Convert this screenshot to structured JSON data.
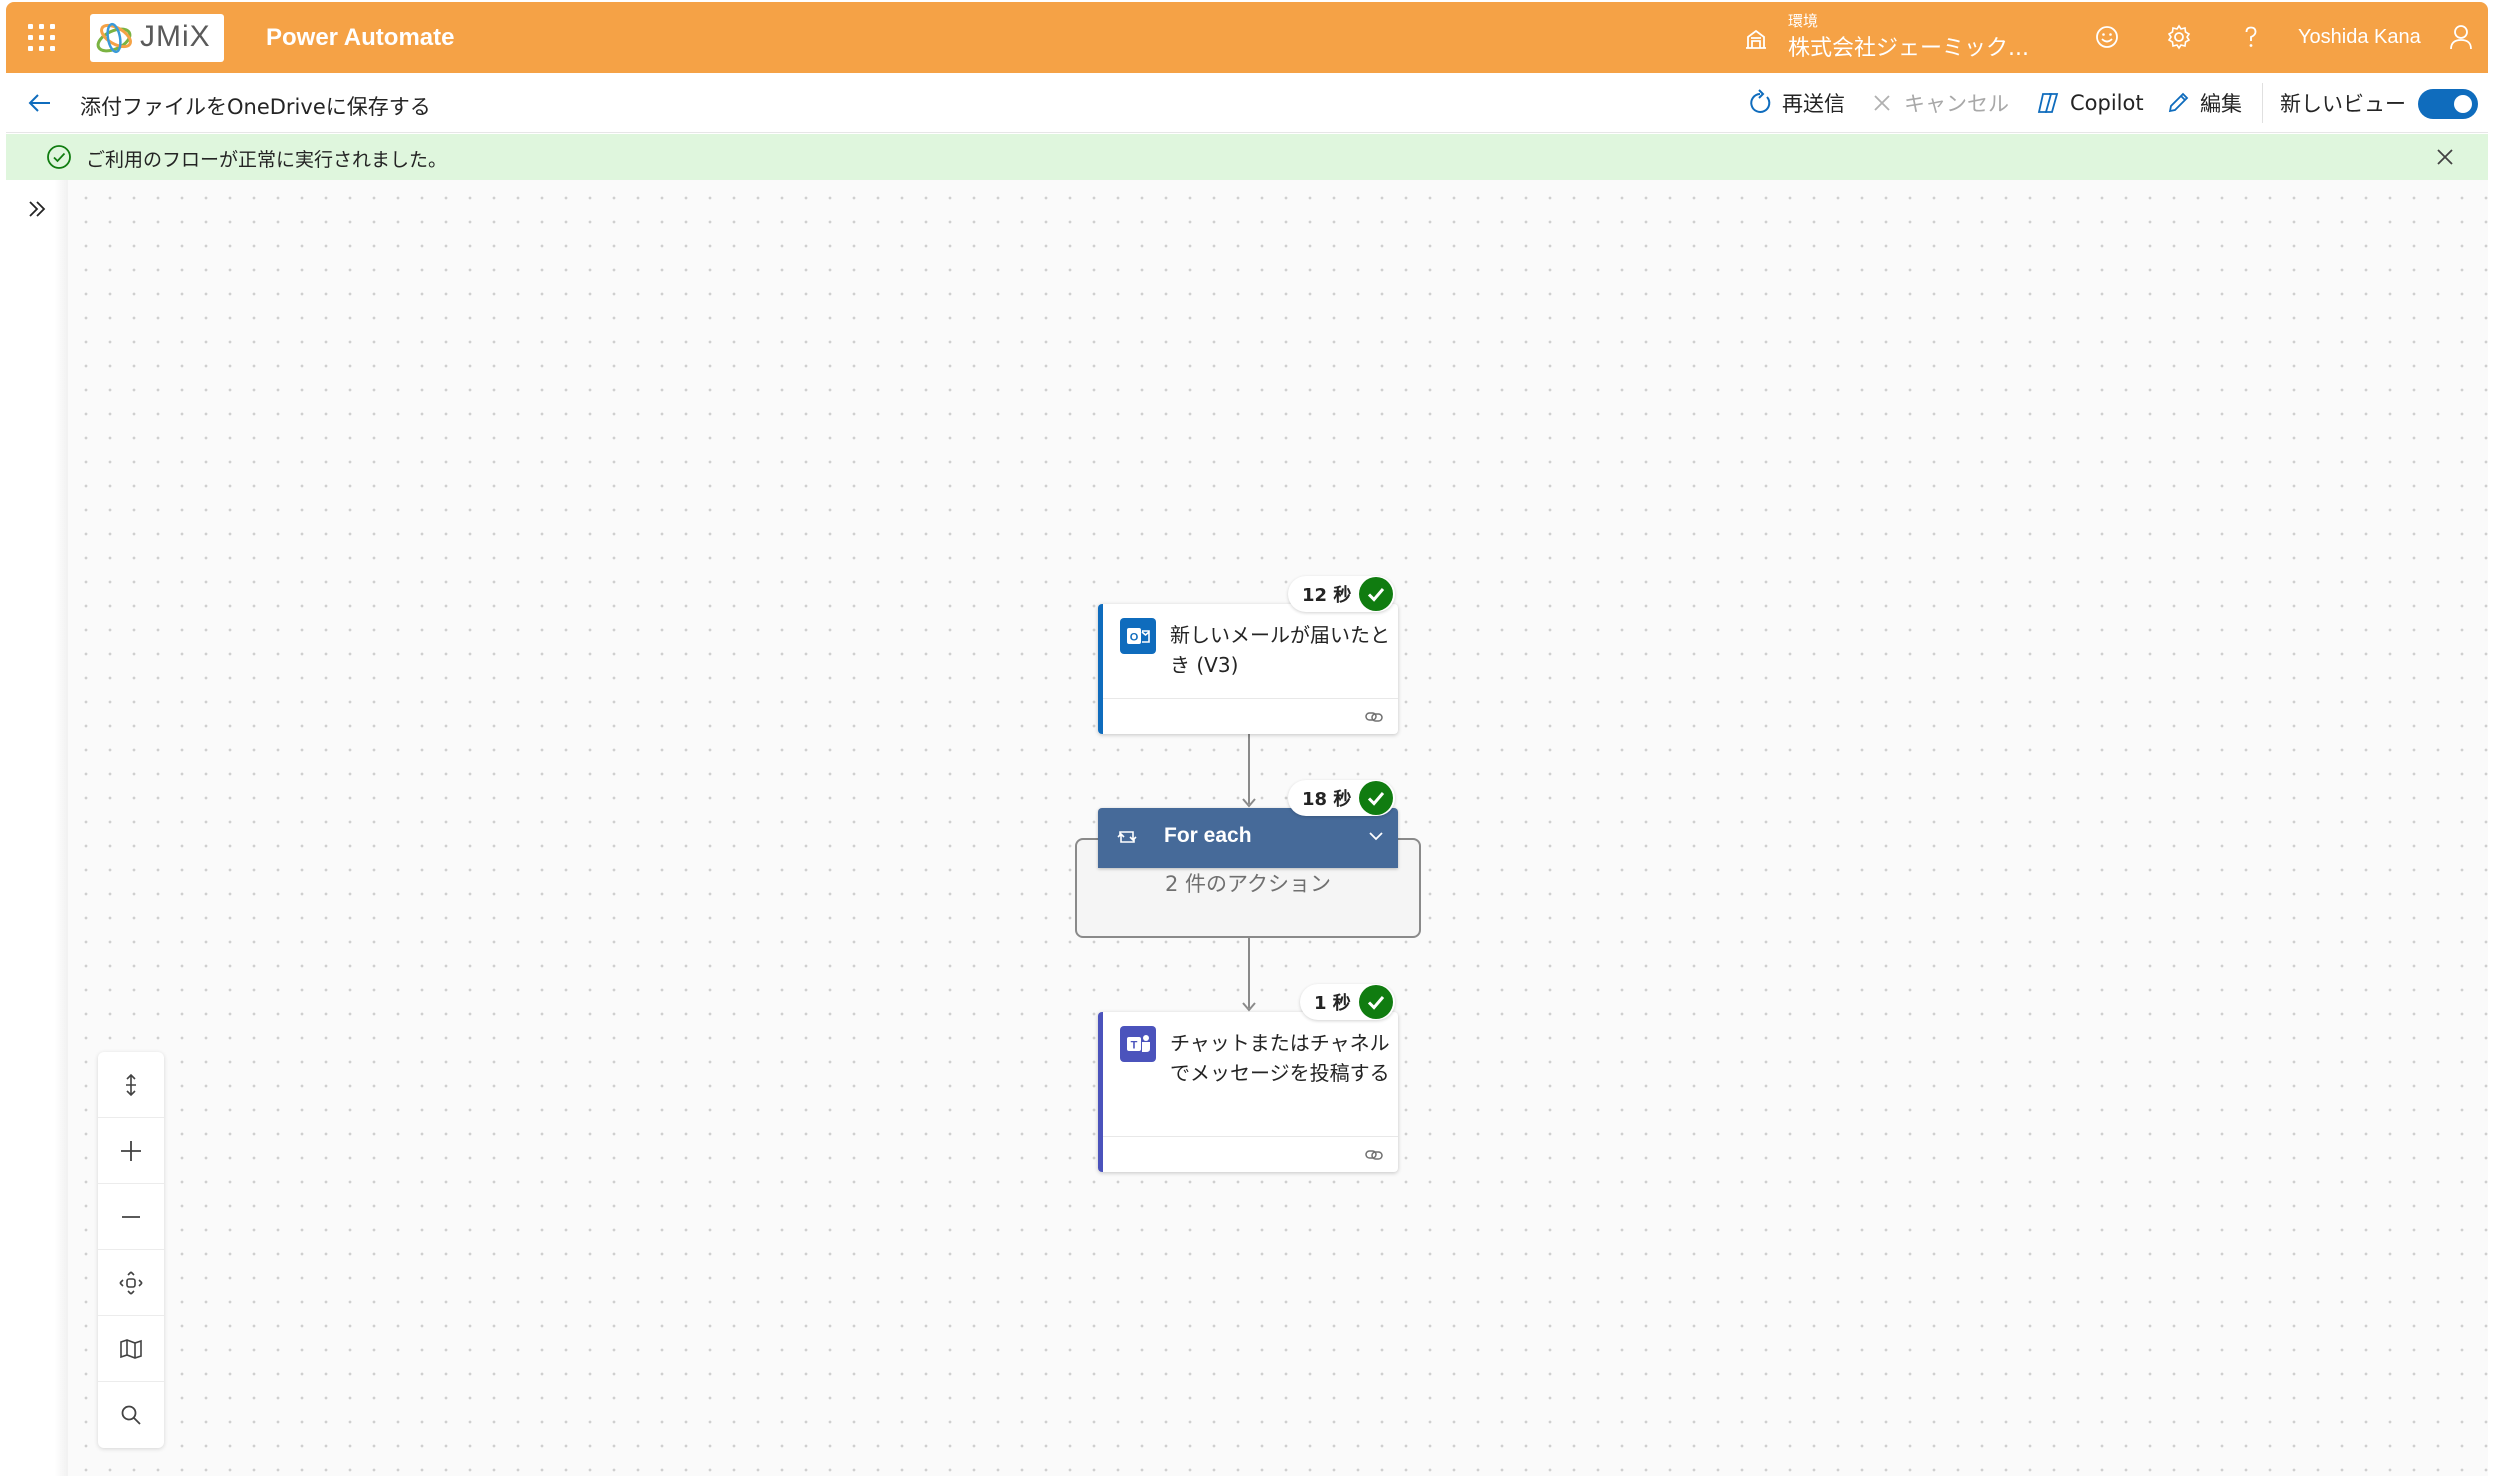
{
  "header": {
    "app_title": "Power Automate",
    "logo_text": "JMiX",
    "environment_label": "環境",
    "environment_name": "株式会社ジェーミック...",
    "user_name": "Yoshida Kana"
  },
  "command_bar": {
    "flow_title": "添付ファイルをOneDriveに保存する",
    "resubmit": "再送信",
    "cancel": "キャンセル",
    "copilot": "Copilot",
    "edit": "編集",
    "new_view_label": "新しいビュー",
    "new_view_enabled": true
  },
  "banner": {
    "message": "ご利用のフローが正常に実行されました。"
  },
  "flow": {
    "trigger": {
      "title": "新しいメールが届いたとき (V3)",
      "duration": "12 秒",
      "status": "succeeded",
      "accent_color": "#0f6cbd",
      "icon": "outlook-icon"
    },
    "foreach": {
      "title": "For each",
      "duration": "18 秒",
      "status": "succeeded",
      "summary": "2 件のアクション",
      "icon": "loop-icon"
    },
    "post_message": {
      "title": "チャットまたはチャネルでメッセージを投稿する",
      "duration": "1 秒",
      "status": "succeeded",
      "accent_color": "#4b53bc",
      "icon": "teams-icon"
    }
  },
  "zoom_controls": [
    "fit-vertical-icon",
    "zoom-in-icon",
    "zoom-out-icon",
    "fit-view-icon",
    "minimap-icon",
    "search-icon"
  ],
  "colors": {
    "header_bg": "#f5a246",
    "banner_bg": "#dff6dd",
    "success_green": "#107c10",
    "foreach_header": "#466a99",
    "toggle_on": "#0f6cbd"
  }
}
